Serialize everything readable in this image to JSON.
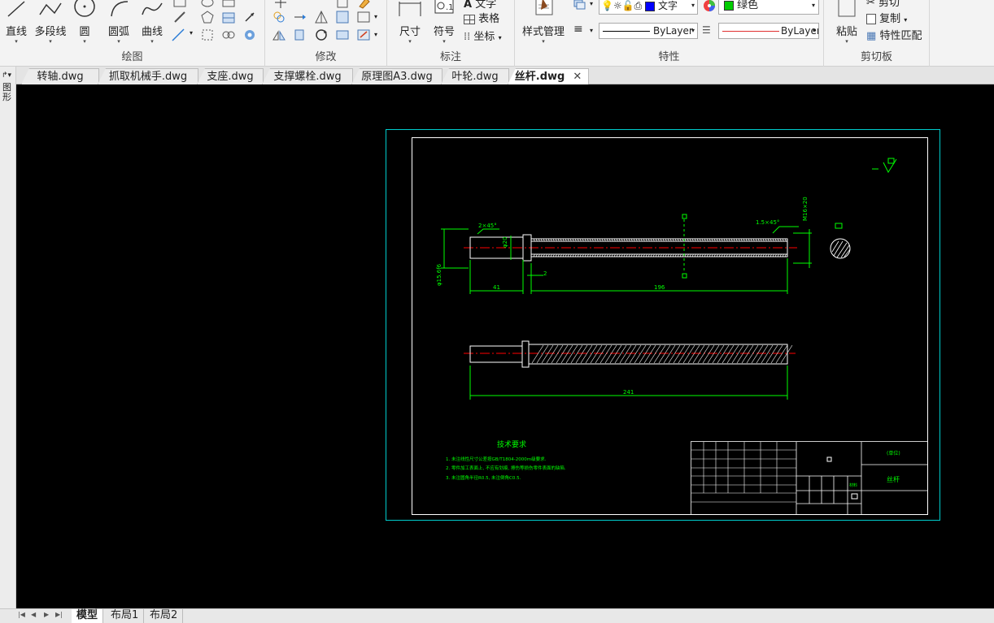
{
  "ribbon": {
    "draw": {
      "line": "直线",
      "polyline": "多段线",
      "circle": "圆",
      "arc": "圆弧",
      "curve": "曲线",
      "group_label": "绘图"
    },
    "modify": {
      "group_label": "修改"
    },
    "annotate": {
      "dimension": "尺寸",
      "symbol": "符号",
      "text": "文字",
      "table": "表格",
      "coordinate": "坐标",
      "group_label": "标注"
    },
    "properties": {
      "style_manager": "样式管理",
      "layer_name": "文字",
      "color_name": "绿色",
      "linetype": "ByLayer",
      "lineweight": "ByLayer",
      "group_label": "特性",
      "color_swatch": "#00cc00"
    },
    "clipboard": {
      "paste": "粘贴",
      "cut": "剪切",
      "copy": "复制",
      "match": "特性匹配",
      "group_label": "剪切板"
    }
  },
  "tabs": [
    {
      "label": "转轴.dwg"
    },
    {
      "label": "抓取机械手.dwg"
    },
    {
      "label": "支座.dwg"
    },
    {
      "label": "支撑螺栓.dwg"
    },
    {
      "label": "原理图A3.dwg"
    },
    {
      "label": "叶轮.dwg"
    },
    {
      "label": "丝杆.dwg",
      "active": true
    }
  ],
  "left_strip": {
    "label": "图形"
  },
  "drawing": {
    "chamfer_left": "2×45°",
    "chamfer_right": "1.5×45°",
    "dim_left_len": "41",
    "dim_main_len": "196",
    "dim_small": "2",
    "dim_total": "241",
    "dim_height": "φ20",
    "dim_side": "M16×20",
    "dim_vertical": "φ15.6f6",
    "tech_title": "技术要求",
    "tech_notes": [
      "1. 未注线性尺寸公差按GB/T1804-2000m级要求.",
      "2. 零件加工表面上, 不应有划痕, 擦伤等损伤零件表面的缺陷.",
      "3. 未注圆角半径R0.5, 未注倒角C0.5."
    ],
    "title_block": {
      "part_name": "丝杆",
      "unit_label": "(单位)",
      "material_label": "材料"
    }
  },
  "bottom": {
    "model_tab": "模型",
    "layout1": "布局1",
    "layout2": "布局2"
  },
  "colors": {
    "canvas": "#000000",
    "geometry_white": "#ffffff",
    "dimension_green": "#00ff00",
    "centerline_red": "#ff0000",
    "frame_cyan": "#00cccc"
  }
}
